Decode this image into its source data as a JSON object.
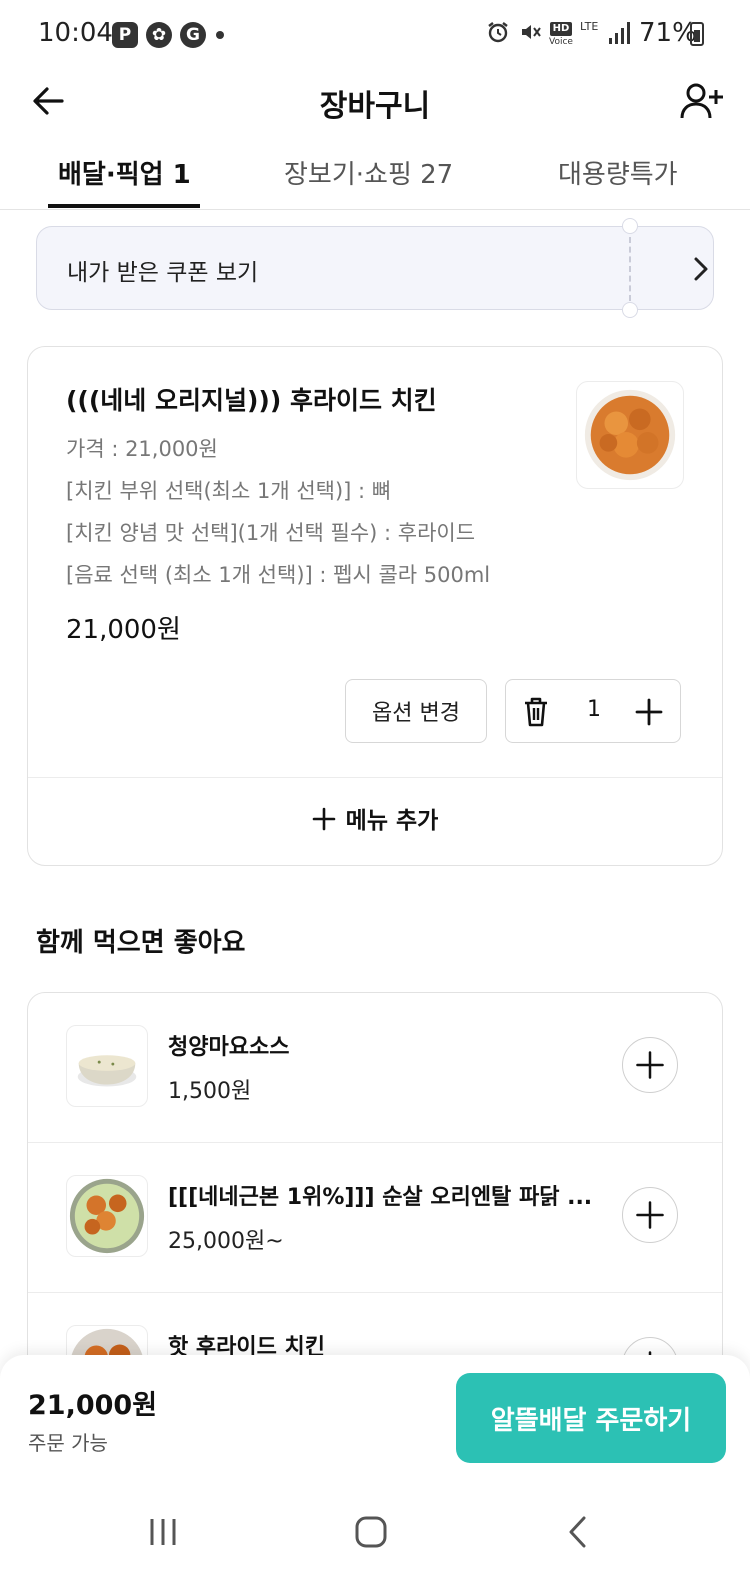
{
  "status_bar": {
    "time": "10:04",
    "app_icons": [
      "P",
      "✿",
      "G"
    ],
    "hd_label": "HD",
    "voice_label": "Voice",
    "lte_label": "LTE",
    "battery": "71%"
  },
  "header": {
    "title": "장바구니",
    "back_icon": "arrow-left-icon",
    "add_user_icon": "user-plus-icon"
  },
  "tabs": [
    {
      "label": "배달·픽업 1",
      "active": true
    },
    {
      "label": "장보기·쇼핑 27",
      "active": false
    },
    {
      "label": "대용량특가",
      "active": false
    }
  ],
  "coupon": {
    "label": "내가 받은 쿠폰 보기"
  },
  "cart_item": {
    "name": "(((네네 오리지널))) 후라이드 치킨",
    "options": [
      "가격 : 21,000원",
      "[치킨 부위 선택(최소 1개 선택)] : 뼈",
      "[치킨 양념 맛 선택](1개 선택 필수) : 후라이드",
      "[음료 선택 (최소 1개 선택)] : 펩시 콜라 500ml"
    ],
    "price": "21,000원",
    "option_change_label": "옵션 변경",
    "quantity": "1",
    "add_menu_label": "메뉴 추가"
  },
  "recommend": {
    "title": "함께 먹으면 좋아요",
    "items": [
      {
        "name": "청양마요소스",
        "price": "1,500원"
      },
      {
        "name": "[[[네네근본 1위%]]] 순살 오리엔탈 파닭 ...",
        "price": "25,000원~"
      },
      {
        "name": "핫 후라이드 치킨",
        "price": ""
      }
    ]
  },
  "order_bar": {
    "total": "21,000원",
    "status": "주문 가능",
    "button_label": "알뜰배달 주문하기"
  },
  "colors": {
    "accent": "#2cc1b4",
    "coupon_bg": "#f4f5fb"
  }
}
